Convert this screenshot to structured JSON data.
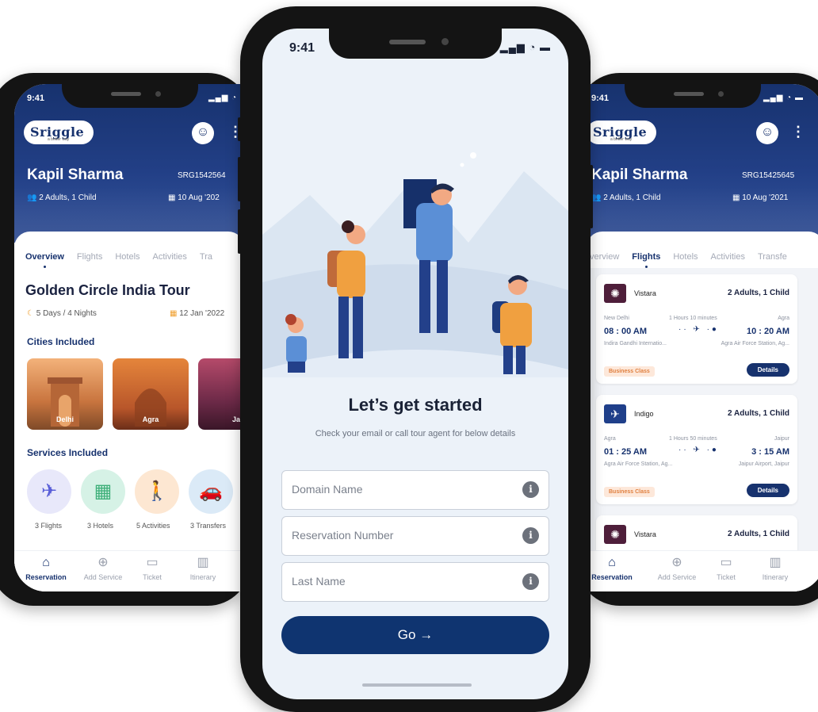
{
  "left_phone": {
    "status_time": "9:41",
    "brand": "Sriggle",
    "brand_tagline": "a better way",
    "traveler_name": "Kapil Sharma",
    "booking_code": "SRG1542564",
    "pax": "2 Adults, 1 Child",
    "date": "10 Aug '202",
    "tabs": [
      "Overview",
      "Flights",
      "Hotels",
      "Activities",
      "Tra"
    ],
    "active_tab": "Overview",
    "tour_title": "Golden Circle India Tour",
    "duration": "5 Days / 4 Nights",
    "start_date": "12 Jan '2022",
    "cities_heading": "Cities Included",
    "cities": [
      "Delhi",
      "Agra",
      "Ja"
    ],
    "services_heading": "Services Included",
    "services": [
      "3 Flights",
      "3 Hotels",
      "5 Activities",
      "3 Transfers"
    ],
    "nav": [
      "Reservation",
      "Add Service",
      "Ticket",
      "Itinerary"
    ]
  },
  "center_phone": {
    "status_time": "9:41",
    "heading": "Let’s get started",
    "subtitle": "Check your email or call tour agent for below details",
    "fields": {
      "domain": "Domain Name",
      "reservation": "Reservation Number",
      "last_name": "Last Name"
    },
    "go_label": "Go →"
  },
  "right_phone": {
    "status_time": "9:41",
    "brand": "Sriggle",
    "brand_tagline": "a better way",
    "traveler_name": "Kapil Sharma",
    "booking_code": "SRG15425645",
    "pax": "2 Adults, 1 Child",
    "date": "10 Aug '2021",
    "tabs": [
      "verview",
      "Flights",
      "Hotels",
      "Activities",
      "Transfe"
    ],
    "active_tab": "Flights",
    "flights": [
      {
        "airline": "Vistara",
        "pax": "2 Adults, 1 Child",
        "from_city": "New Delhi",
        "duration": "1 Hours 10 minutes",
        "to_city": "Agra",
        "dep_time": "08 : 00 AM",
        "arr_time": "10 : 20 AM",
        "from_airport": "Indira Gandhi Internatio...",
        "to_airport": "Agra Air Force Station, Ag...",
        "class": "Business Class",
        "details": "Details"
      },
      {
        "airline": "Indigo",
        "pax": "2 Adults, 1 Child",
        "from_city": "Agra",
        "duration": "1 Hours 50 minutes",
        "to_city": "Jaipur",
        "dep_time": "01 : 25 AM",
        "arr_time": "3 : 15 AM",
        "from_airport": "Agra Air Force Station, Ag...",
        "to_airport": "Jaipur Airport, Jaipur",
        "class": "Business Class",
        "details": "Details"
      },
      {
        "airline": "Vistara",
        "pax": "2 Adults, 1 Child"
      }
    ],
    "nav": [
      "Reservation",
      "Add Service",
      "Ticket",
      "Itinerary"
    ]
  },
  "colors": {
    "brand_navy": "#0f3470",
    "accent_orange": "#f0a030",
    "screen_bg": "#ecf2f9"
  }
}
